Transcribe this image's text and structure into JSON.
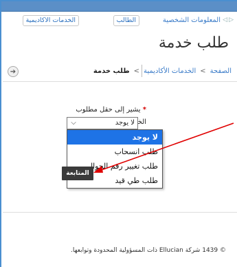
{
  "header": {
    "personal_info": "المعلومات الشخصية",
    "tab_students": "الطالب",
    "tab_services": "الخدمات الاكاديمية"
  },
  "page": {
    "title": "طلب خدمة"
  },
  "breadcrumb": {
    "home": "الصفحة",
    "sep": ">",
    "academic_services": "الخدمات الأكاديمية",
    "current": "طلب خدمة"
  },
  "form": {
    "required_note": "يشير إلى حقل مطلوب",
    "service_label": "الخدمة:",
    "selected_value": "لا يوجد",
    "options": [
      "لا يوجد",
      "طلب انسحاب",
      "طلب تغيير رقم الجوال",
      "طلب طي قيد"
    ],
    "submit_label": "المتابعة"
  },
  "footer": {
    "text": "© 1439 شركة Ellucian ذات المسؤولية المحدودة وتوابعها."
  },
  "colors": {
    "accent": "#1e73e6",
    "required": "#d40000",
    "arrow": "#e00000"
  }
}
